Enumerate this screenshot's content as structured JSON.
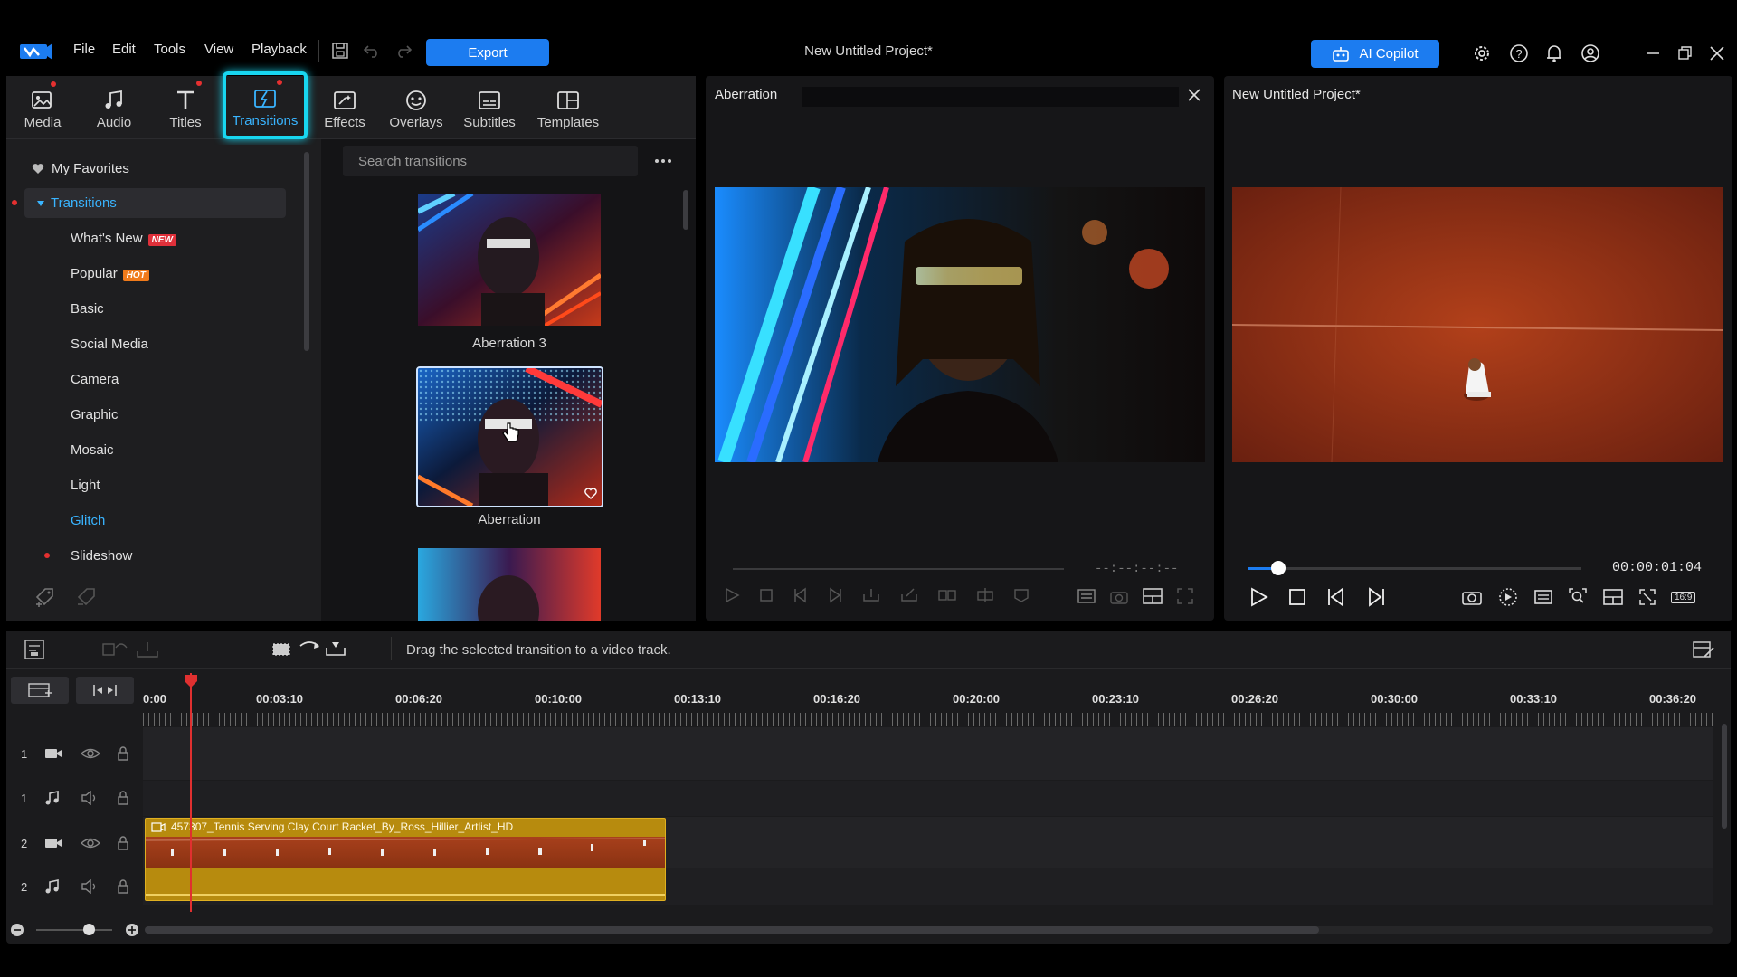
{
  "menu": {
    "items": [
      "File",
      "Edit",
      "Tools",
      "View",
      "Playback"
    ],
    "export_label": "Export",
    "project_title": "New Untitled Project*",
    "ai_copilot_label": "AI Copilot"
  },
  "tabs": [
    {
      "label": "Media",
      "icon": "media-icon"
    },
    {
      "label": "Audio",
      "icon": "audio-icon"
    },
    {
      "label": "Titles",
      "icon": "titles-icon"
    },
    {
      "label": "Transitions",
      "icon": "transitions-icon",
      "active": true
    },
    {
      "label": "Effects",
      "icon": "effects-icon"
    },
    {
      "label": "Overlays",
      "icon": "overlays-icon"
    },
    {
      "label": "Subtitles",
      "icon": "subtitles-icon"
    },
    {
      "label": "Templates",
      "icon": "templates-icon"
    }
  ],
  "tree": {
    "favorites": "My Favorites",
    "root": "Transitions",
    "items": [
      {
        "label": "What's New",
        "badge": "NEW"
      },
      {
        "label": "Popular",
        "badge": "HOT"
      },
      {
        "label": "Basic"
      },
      {
        "label": "Social Media"
      },
      {
        "label": "Camera"
      },
      {
        "label": "Graphic"
      },
      {
        "label": "Mosaic"
      },
      {
        "label": "Light"
      },
      {
        "label": "Glitch",
        "selected": true
      },
      {
        "label": "Slideshow"
      }
    ]
  },
  "search": {
    "placeholder": "Search transitions"
  },
  "transitions": [
    {
      "name": "Aberration 3"
    },
    {
      "name": "Aberration",
      "selected": true
    },
    {
      "name": ""
    }
  ],
  "clip_preview": {
    "title": "Aberration",
    "timecode": "--:--:--:--"
  },
  "project_preview": {
    "title": "New Untitled Project*",
    "timecode": "00:00:01:04",
    "aspect": "16:9"
  },
  "timeline": {
    "hint": "Drag the selected transition to a video track.",
    "ruler": [
      "0:00",
      "00:03:10",
      "00:06:20",
      "00:10:00",
      "00:13:10",
      "00:16:20",
      "00:20:00",
      "00:23:10",
      "00:26:20",
      "00:30:00",
      "00:33:10",
      "00:36:20"
    ],
    "tracks": [
      {
        "num": "1",
        "type": "video"
      },
      {
        "num": "1",
        "type": "audio"
      },
      {
        "num": "2",
        "type": "video"
      },
      {
        "num": "2",
        "type": "audio"
      }
    ],
    "clip_name": "457307_Tennis Serving Clay Court Racket_By_Ross_Hillier_Artlist_HD"
  },
  "colors": {
    "accent": "#1c7cf0",
    "highlight": "#18d6f0",
    "playhead": "#e03030",
    "clip": "#b78b0e",
    "badge_new": "#e0303a",
    "badge_hot": "#f07a1a"
  }
}
